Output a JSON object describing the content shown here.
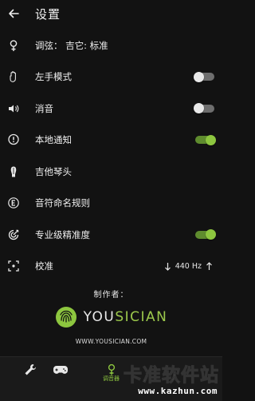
{
  "header": {
    "title": "设置"
  },
  "settings": [
    {
      "label": "调弦： 吉它: 标准",
      "icon": "tuner-fork-icon"
    },
    {
      "label": "左手模式",
      "icon": "left-hand-icon",
      "toggle": "off"
    },
    {
      "label": "消音",
      "icon": "speaker-icon",
      "toggle": "off"
    },
    {
      "label": "本地通知",
      "icon": "notification-icon",
      "toggle": "on"
    },
    {
      "label": "吉他琴头",
      "icon": "guitar-head-icon"
    },
    {
      "label": "音符命名规则",
      "icon": "notation-e-icon"
    },
    {
      "label": "专业级精准度",
      "icon": "precision-target-icon",
      "toggle": "on"
    },
    {
      "label": "校准",
      "icon": "calibrate-icon",
      "value": "440 Hz"
    }
  ],
  "credits": {
    "by": "制作者：",
    "logo_you": "YOU",
    "logo_sician": "SICIAN",
    "site": "WWW.YOUSICIAN.COM"
  },
  "bottom_nav": {
    "active_label": "调音器"
  },
  "watermark": {
    "title": "卡准软件站",
    "url": "www.kazhun.com"
  },
  "colors": {
    "background": "#121212",
    "accent": "#8dc63f",
    "toggle_off": "#6e6e6e"
  }
}
